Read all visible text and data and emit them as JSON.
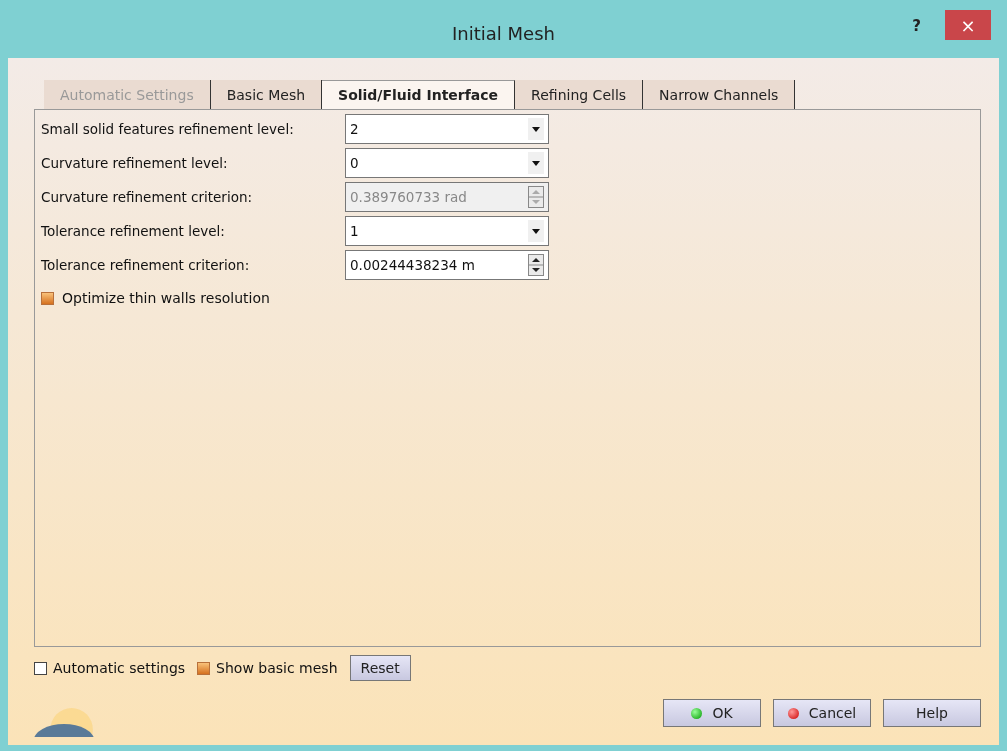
{
  "window": {
    "title": "Initial Mesh",
    "help": "?",
    "close": "×"
  },
  "tabs": [
    {
      "label": "Automatic Settings",
      "selected": false,
      "disabled": true
    },
    {
      "label": "Basic Mesh",
      "selected": false,
      "disabled": false
    },
    {
      "label": "Solid/Fluid Interface",
      "selected": true,
      "disabled": false
    },
    {
      "label": "Refining Cells",
      "selected": false,
      "disabled": false
    },
    {
      "label": "Narrow Channels",
      "selected": false,
      "disabled": false
    }
  ],
  "fields": [
    {
      "label": "Small solid features refinement level:",
      "value": "2",
      "kind": "dropdown",
      "disabled": false
    },
    {
      "label": "Curvature refinement level:",
      "value": "0",
      "kind": "dropdown",
      "disabled": false
    },
    {
      "label": "Curvature refinement criterion:",
      "value": "0.389760733 rad",
      "kind": "spinner",
      "disabled": true
    },
    {
      "label": "Tolerance refinement level:",
      "value": "1",
      "kind": "dropdown",
      "disabled": false
    },
    {
      "label": "Tolerance refinement criterion:",
      "value": "0.00244438234 m",
      "kind": "spinner",
      "disabled": false
    }
  ],
  "optimize": {
    "label": "Optimize thin walls resolution",
    "checked": true
  },
  "footer_options": [
    {
      "label": "Automatic settings",
      "checked": false
    },
    {
      "label": "Show basic mesh",
      "checked": true
    }
  ],
  "reset": "Reset",
  "buttons": [
    {
      "label": "OK",
      "kind": "ok"
    },
    {
      "label": "Cancel",
      "kind": "cancel"
    },
    {
      "label": "Help",
      "kind": "plain"
    }
  ]
}
